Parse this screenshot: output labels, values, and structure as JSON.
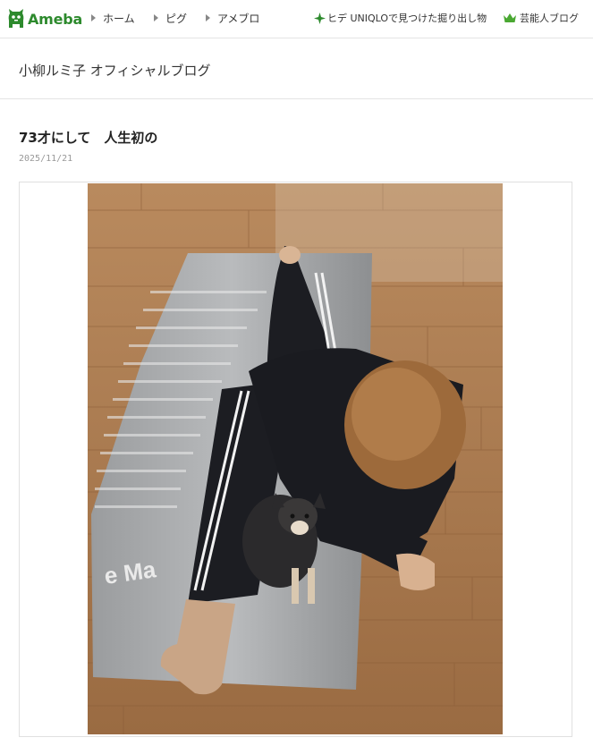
{
  "header": {
    "logo_text": "Ameba",
    "nav": [
      {
        "label": "ホーム"
      },
      {
        "label": "ピグ"
      },
      {
        "label": "アメブロ"
      }
    ],
    "promo": {
      "label": "ヒデ UNIQLOで見つけた掘り出し物"
    },
    "celebrity": {
      "label": "芸能人ブログ"
    }
  },
  "blog": {
    "title": "小柳ルミ子 オフィシャルブログ"
  },
  "entry": {
    "title": "73才にして　人生初の",
    "date": "2025/11/21"
  },
  "colors": {
    "brand_green": "#2d8a2d",
    "crown": "#4aa832"
  },
  "icons": [
    "ameba-logo-icon",
    "nav-arrow-icon",
    "sparkle-icon",
    "crown-icon"
  ]
}
